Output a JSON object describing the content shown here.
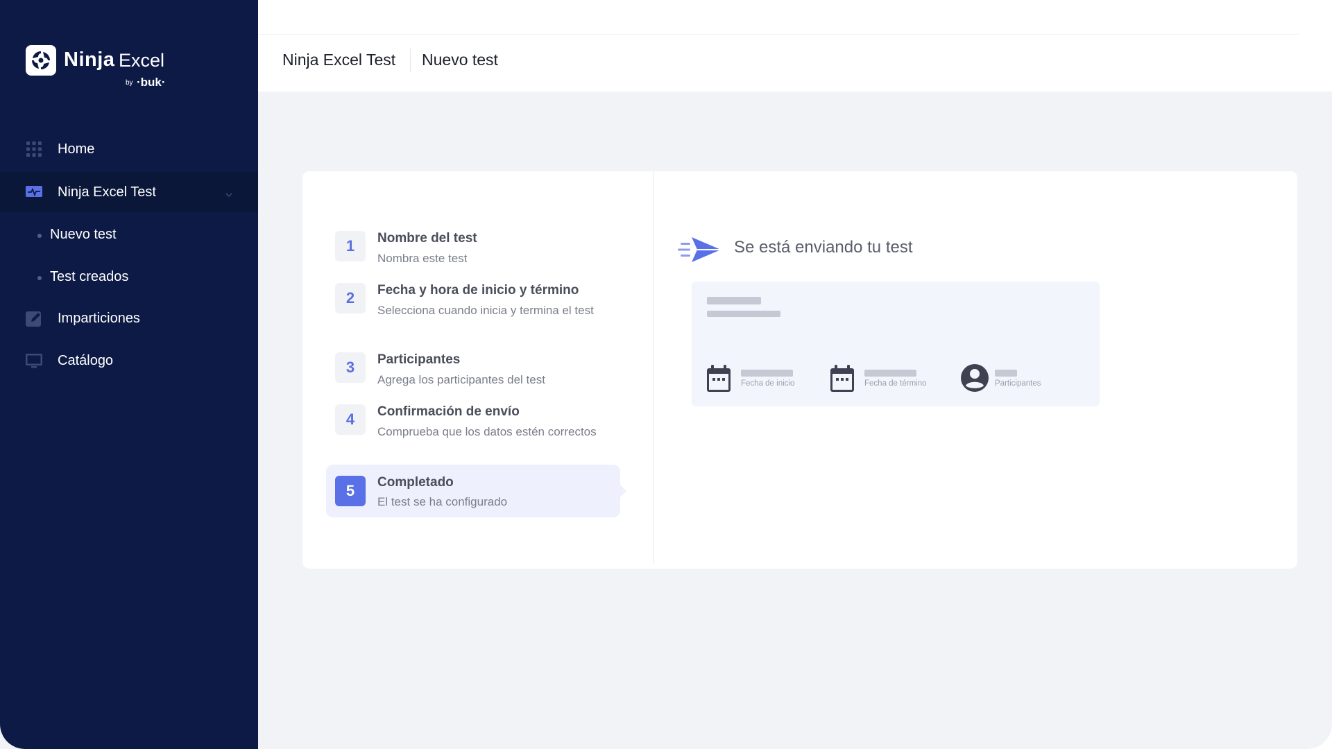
{
  "brand": {
    "name": "Ninja",
    "product": "Excel",
    "by": "by",
    "company": "·buk·"
  },
  "sidebar": {
    "items": [
      {
        "label": "Home",
        "icon": "grid-icon"
      },
      {
        "label": "Ninja Excel Test",
        "icon": "activity-monitor-icon",
        "expanded": true
      },
      {
        "label": "Imparticiones",
        "icon": "edit-icon"
      },
      {
        "label": "Catálogo",
        "icon": "monitor-icon"
      }
    ],
    "subitems": [
      {
        "label": "Nuevo test"
      },
      {
        "label": "Test creados"
      }
    ]
  },
  "header": {
    "section": "Ninja Excel Test",
    "page": "Nuevo test"
  },
  "steps": [
    {
      "number": "1",
      "title": "Nombre del test",
      "description": "Nombra este test"
    },
    {
      "number": "2",
      "title": "Fecha y hora de inicio y término",
      "description": "Selecciona cuando inicia y termina el test"
    },
    {
      "number": "3",
      "title": "Participantes",
      "description": "Agrega los participantes del test"
    },
    {
      "number": "4",
      "title": "Confirmación de envío",
      "description": "Comprueba que los datos estén correctos"
    },
    {
      "number": "5",
      "title": "Completado",
      "description": "El test se ha configurado",
      "active": true
    }
  ],
  "status": {
    "title": "Se está enviando tu test",
    "icon": "send-plane-icon"
  },
  "preview": {
    "start_label": "Fecha de inicio",
    "end_label": "Fecha de término",
    "participants_label": "Participantes"
  },
  "colors": {
    "sidebar_bg": "#0d1a45",
    "accent": "#5a70e6",
    "page_bg": "#f2f3f7"
  }
}
